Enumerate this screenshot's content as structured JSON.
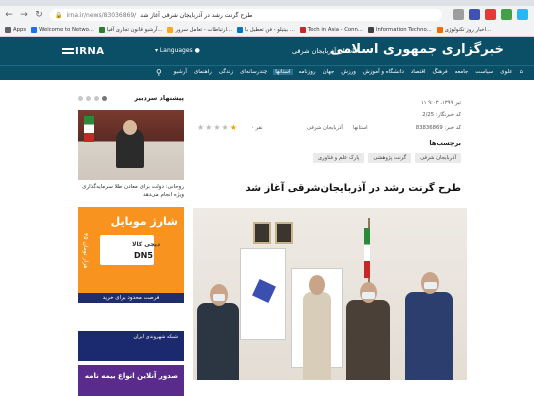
{
  "browser": {
    "url": "irna.ir/news/83036869/",
    "tab_title": "طرح گرنت رشد در آذربایجان شرقی آغاز شد",
    "bookmarks": [
      {
        "label": "Apps",
        "color": "#5f6368"
      },
      {
        "label": "Welcome to Netwo...",
        "color": "#1a73e8"
      },
      {
        "label": "آرشیو قانون تجاری آفیا...",
        "color": "#2e7d32"
      },
      {
        "label": "ارتباطات - تعامل سرور...",
        "color": "#f9a825"
      },
      {
        "label": "بیتیلو - فن تعطیل با ...",
        "color": "#0277bd"
      },
      {
        "label": "Tech in Asia - Conn...",
        "color": "#c62828"
      },
      {
        "label": "Information Techno...",
        "color": "#424242"
      },
      {
        "label": "اخبار روز تکنولوژی...",
        "color": "#ef6c00"
      }
    ]
  },
  "header": {
    "logo": "IRNA",
    "agency_title": "خبرگزاری جمهوری اسلامی",
    "province": "استان آذربایجان شرقی",
    "languages_label": "Languages",
    "bg_color": "#0b4f66"
  },
  "nav": {
    "items": [
      "خانه",
      "علوی",
      "سیاست",
      "جامعه",
      "فرهنگ",
      "اقتصاد",
      "دانشگاه و آموزش",
      "ورزش",
      "جهان",
      "روزنامه",
      "استانها",
      "چندرسانه‌ای",
      "زندگی",
      "راهنمای",
      "آرشیو"
    ],
    "active_index": 10
  },
  "sidebar": {
    "title": "پیشنهاد سردبیر",
    "caption": "روحانی: دولت برای معادن طلا سرمایه‌گذاری ویژه انجام می‌دهد",
    "ad1_title": "شارژ موبایل",
    "ad1_brand": "دیجی کالا",
    "ad1_model": "DN5",
    "ad1_side": "۳۵ هزار تومان",
    "ad1_footer": "فرصت محدود برای خرید",
    "ad2_text": "شبکه شهروندی ایران",
    "ad3_text": "صدور آنلاین انواع بیمه نامه"
  },
  "article": {
    "date": "۱۱ تیر ۱۳۹۹، ۹:۰۳",
    "news_code_label": "کد خبرنگار: 2/25",
    "news_code": "کد خبر: 83836869",
    "category_1": "استانها",
    "category_2": "آذربایجان شرقی",
    "rating_count": "۰ نفر",
    "rating": 1,
    "tags_label": "برچسب‌ها",
    "tags": [
      "آذربایجان شرقی",
      "گرنت پژوهشی",
      "پارک علم و فناوری"
    ],
    "headline": "طرح گرنت رشد در آذربایجان‌شرقی آغاز شد"
  }
}
